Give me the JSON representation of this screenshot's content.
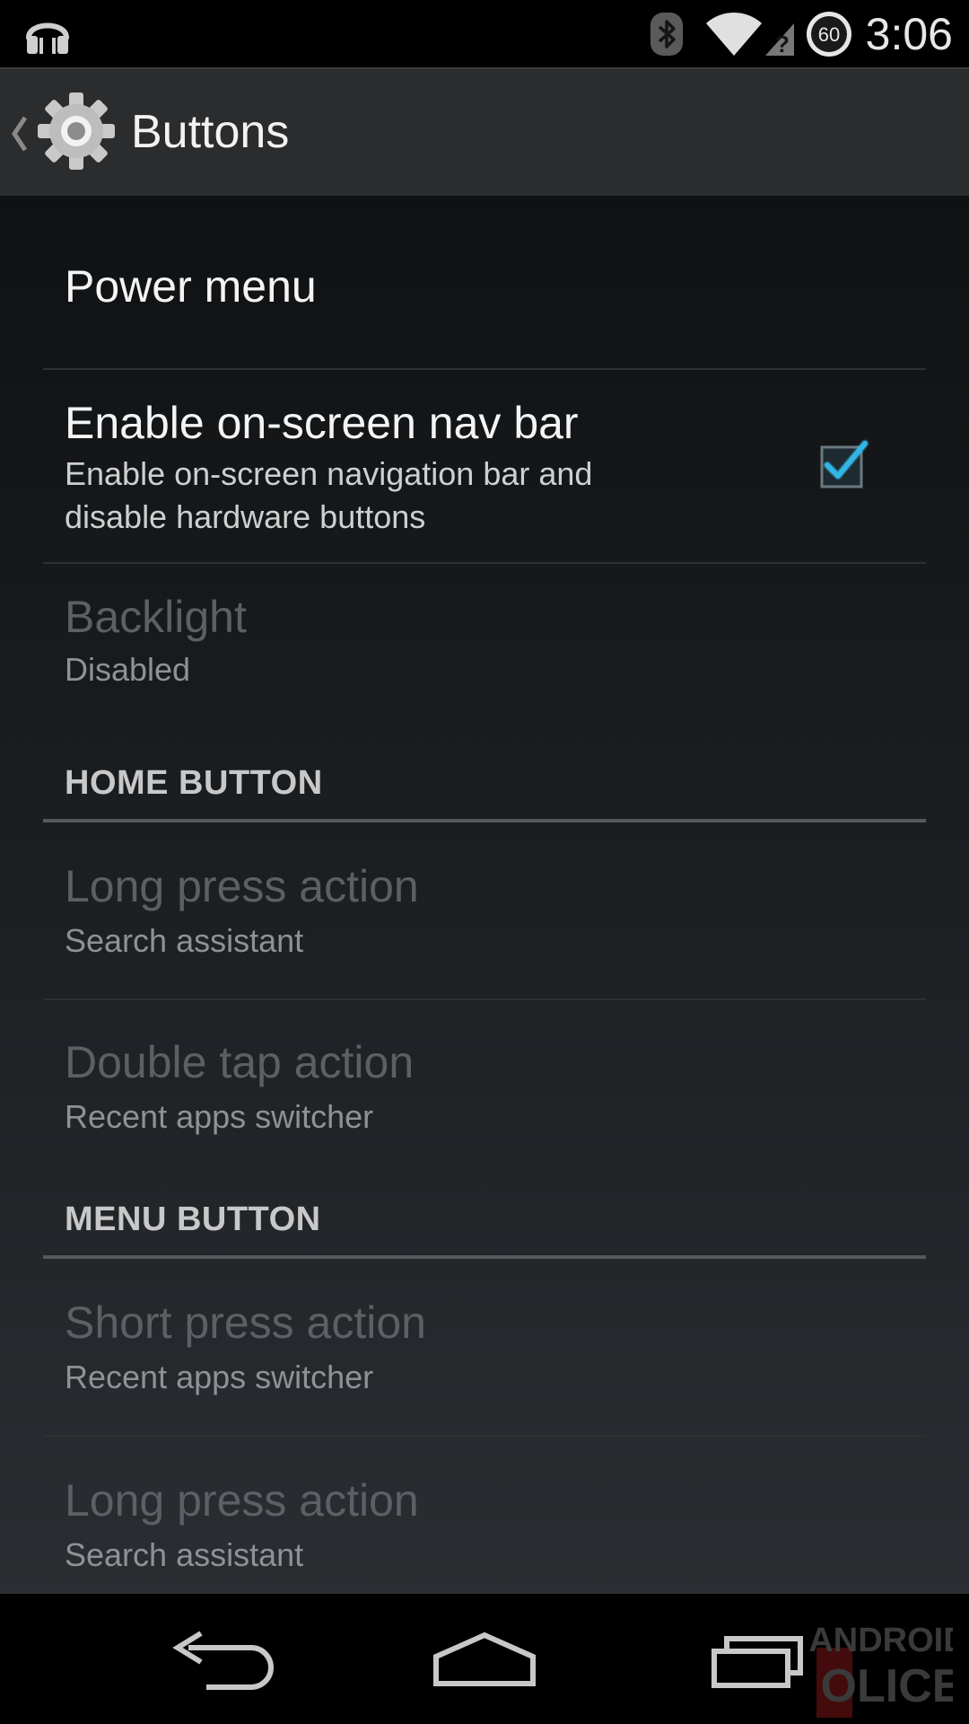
{
  "status_bar": {
    "time": "3:06",
    "badge": "60",
    "icons": [
      "headphones-icon",
      "bluetooth-icon",
      "wifi-icon",
      "sim-unknown-icon",
      "badge-icon"
    ]
  },
  "action_bar": {
    "title": "Buttons",
    "icon": "gear-icon"
  },
  "preferences": {
    "power_menu": {
      "title": "Power menu"
    },
    "nav_bar": {
      "title": "Enable on-screen nav bar",
      "summary_line1": "Enable on-screen navigation bar and",
      "summary_line2": "disable hardware buttons",
      "checked": true
    },
    "backlight": {
      "title": "Backlight",
      "summary": "Disabled"
    }
  },
  "home_button": {
    "header": "HOME BUTTON",
    "long_press": {
      "title": "Long press action",
      "summary": "Search assistant"
    },
    "double_tap": {
      "title": "Double tap action",
      "summary": "Recent apps switcher"
    }
  },
  "menu_button": {
    "header": "MENU BUTTON",
    "short_press": {
      "title": "Short press action",
      "summary": "Recent apps switcher"
    },
    "long_press": {
      "title": "Long press action",
      "summary": "Search assistant"
    }
  },
  "nav_bar_buttons": [
    "back-icon",
    "home-icon",
    "recents-icon"
  ],
  "watermark": "ANDROID POLICE",
  "colors": {
    "accent": "#33b5e5",
    "action_bar": "#2b2c2e",
    "text_primary": "#f4f4f4",
    "text_disabled": "#5c5f63"
  }
}
